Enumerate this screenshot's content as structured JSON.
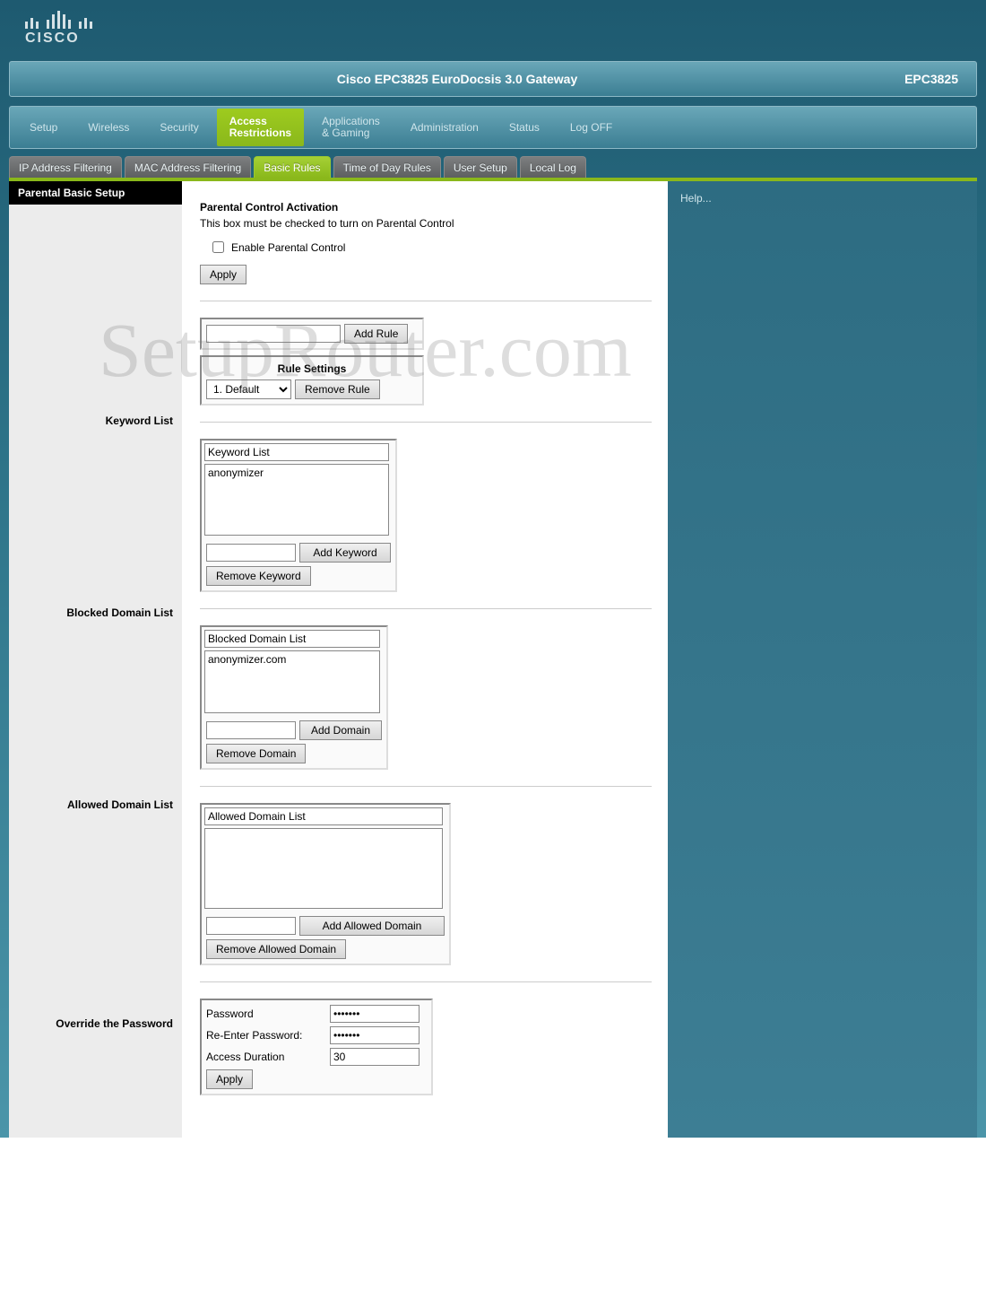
{
  "brand": "CISCO",
  "title_bar": {
    "title": "Cisco EPC3825 EuroDocsis 3.0 Gateway",
    "model": "EPC3825"
  },
  "main_nav": {
    "items": [
      {
        "label": "Setup"
      },
      {
        "label": "Wireless"
      },
      {
        "label": "Security"
      },
      {
        "label1": "Access",
        "label2": "Restrictions",
        "active": true
      },
      {
        "label1": "Applications",
        "label2": "& Gaming"
      },
      {
        "label": "Administration"
      },
      {
        "label": "Status"
      },
      {
        "label": "Log OFF"
      }
    ]
  },
  "sub_nav": {
    "items": [
      {
        "label": "IP Address Filtering"
      },
      {
        "label": "MAC Address Filtering"
      },
      {
        "label": "Basic Rules",
        "active": true
      },
      {
        "label": "Time of Day Rules"
      },
      {
        "label": "User Setup"
      },
      {
        "label": "Local Log"
      }
    ]
  },
  "section_title": "Parental Basic Setup",
  "activation": {
    "heading": "Parental Control Activation",
    "desc": "This box must be checked to turn on Parental Control",
    "checkbox_label": "Enable Parental Control",
    "apply": "Apply"
  },
  "rule": {
    "add_rule": "Add Rule",
    "settings_title": "Rule Settings",
    "select_value": "1. Default",
    "select_options": [
      "1. Default"
    ],
    "remove_rule": "Remove Rule"
  },
  "keyword": {
    "label": "Keyword List",
    "box_title": "Keyword List",
    "items": "anonymizer",
    "add": "Add Keyword",
    "remove": "Remove Keyword"
  },
  "blocked": {
    "label": "Blocked Domain List",
    "box_title": "Blocked Domain List",
    "items": "anonymizer.com",
    "add": "Add Domain",
    "remove": "Remove Domain"
  },
  "allowed": {
    "label": "Allowed Domain List",
    "box_title": "Allowed Domain List",
    "items": "",
    "add": "Add Allowed Domain",
    "remove": "Remove Allowed Domain"
  },
  "override": {
    "label": "Override the Password",
    "password_label": "Password",
    "password_value": "•••••••",
    "reenter_label": "Re-Enter Password:",
    "reenter_value": "•••••••",
    "duration_label": "Access Duration",
    "duration_value": "30",
    "apply": "Apply"
  },
  "help": "Help...",
  "watermark": "SetupRouter.com"
}
